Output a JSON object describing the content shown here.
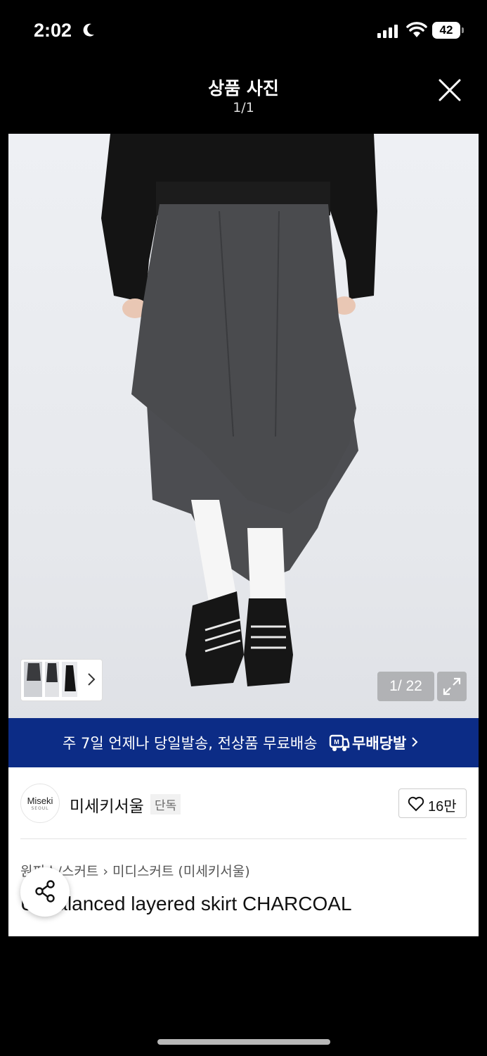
{
  "status_bar": {
    "time": "2:02",
    "battery": "42"
  },
  "header": {
    "title": "상품 사진",
    "counter": "1/1"
  },
  "gallery": {
    "counter": "1/ 22"
  },
  "banner": {
    "text": "주 7일 언제나 당일발송, 전상품 무료배송",
    "brand": "무배당발"
  },
  "brand": {
    "logo_text": "Miseki",
    "logo_sub": "SEOUL",
    "name": "미세키서울",
    "tag": "단독",
    "likes": "16만"
  },
  "product": {
    "breadcrumb": [
      "원피스/스커트",
      "미디스커트 (미세키서울)"
    ],
    "title": "Unbalanced layered skirt CHARCOAL"
  },
  "colors": {
    "banner": "#0c2c86",
    "sweater": "#141414",
    "skirt": "#4a4b4e"
  }
}
